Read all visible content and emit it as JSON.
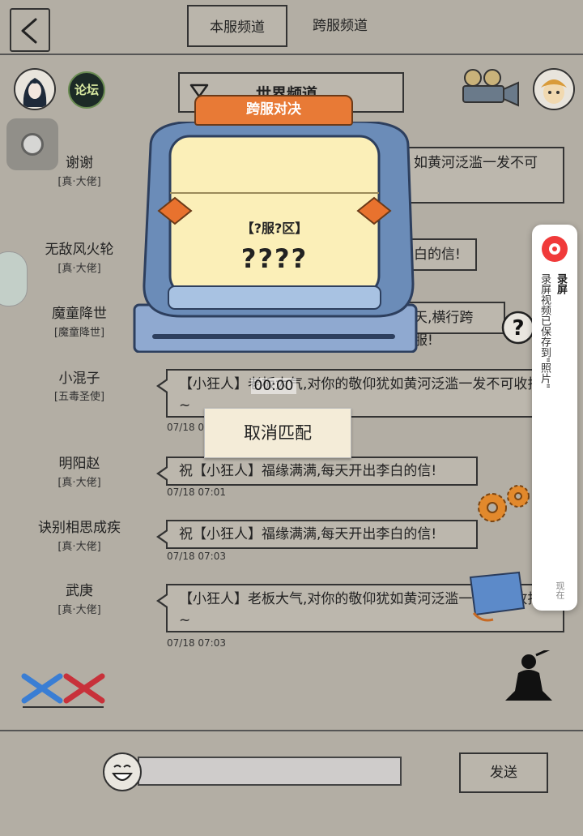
{
  "header": {
    "back_icon": "back-chevron-icon",
    "tabs": [
      {
        "label": "本服频道",
        "active": true
      },
      {
        "label": "跨服频道",
        "active": false
      }
    ],
    "forum_label": "论坛",
    "channel_select": "世界频道"
  },
  "messages": [
    {
      "name": "谢谢",
      "title": "[真·大佬]",
      "text": "如黄河泛滥一发不可",
      "time": ""
    },
    {
      "name": "无敌风火轮",
      "title": "[真·大佬]",
      "text": "白的信!",
      "time": ""
    },
    {
      "name": "魔童降世",
      "title": "[魔童降世]",
      "text": "天,横行跨服!",
      "time": ""
    },
    {
      "name": "小混子",
      "title": "[五毒圣使]",
      "text": "【小狂人】老板大气,对你的敬仰犹如黄河泛滥一发不可收拾~",
      "time": "07/18 07:"
    },
    {
      "name": "明阳赵",
      "title": "[真·大佬]",
      "text": "祝【小狂人】福缘满满,每天开出李白的信!",
      "time": "07/18 07:01"
    },
    {
      "name": "诀别相思成疾",
      "title": "[真·大佬]",
      "text": "祝【小狂人】福缘满满,每天开出李白的信!",
      "time": "07/18 07:03"
    },
    {
      "name": "武庚",
      "title": "[真·大佬]",
      "text": "【小狂人】老板大气,对你的敬仰犹如黄河泛滥一发不可收拾~",
      "time": "07/18 07:03"
    }
  ],
  "match_modal": {
    "title": "跨服对决",
    "server_label": "【?服?区】",
    "opponent": "????",
    "timer": "00:00",
    "cancel_label": "取消匹配"
  },
  "recording_notice": {
    "title": "录屏",
    "message": "录屏视频已保存到\"照片\"",
    "time": "现在"
  },
  "footer": {
    "input_value": "",
    "send_label": "发送"
  },
  "colors": {
    "background": "#b3aea4",
    "modal_title": "#e87a36",
    "machine_body": "#6b8cb8",
    "screen": "#fbefb8",
    "record_red": "#f03a3a"
  }
}
